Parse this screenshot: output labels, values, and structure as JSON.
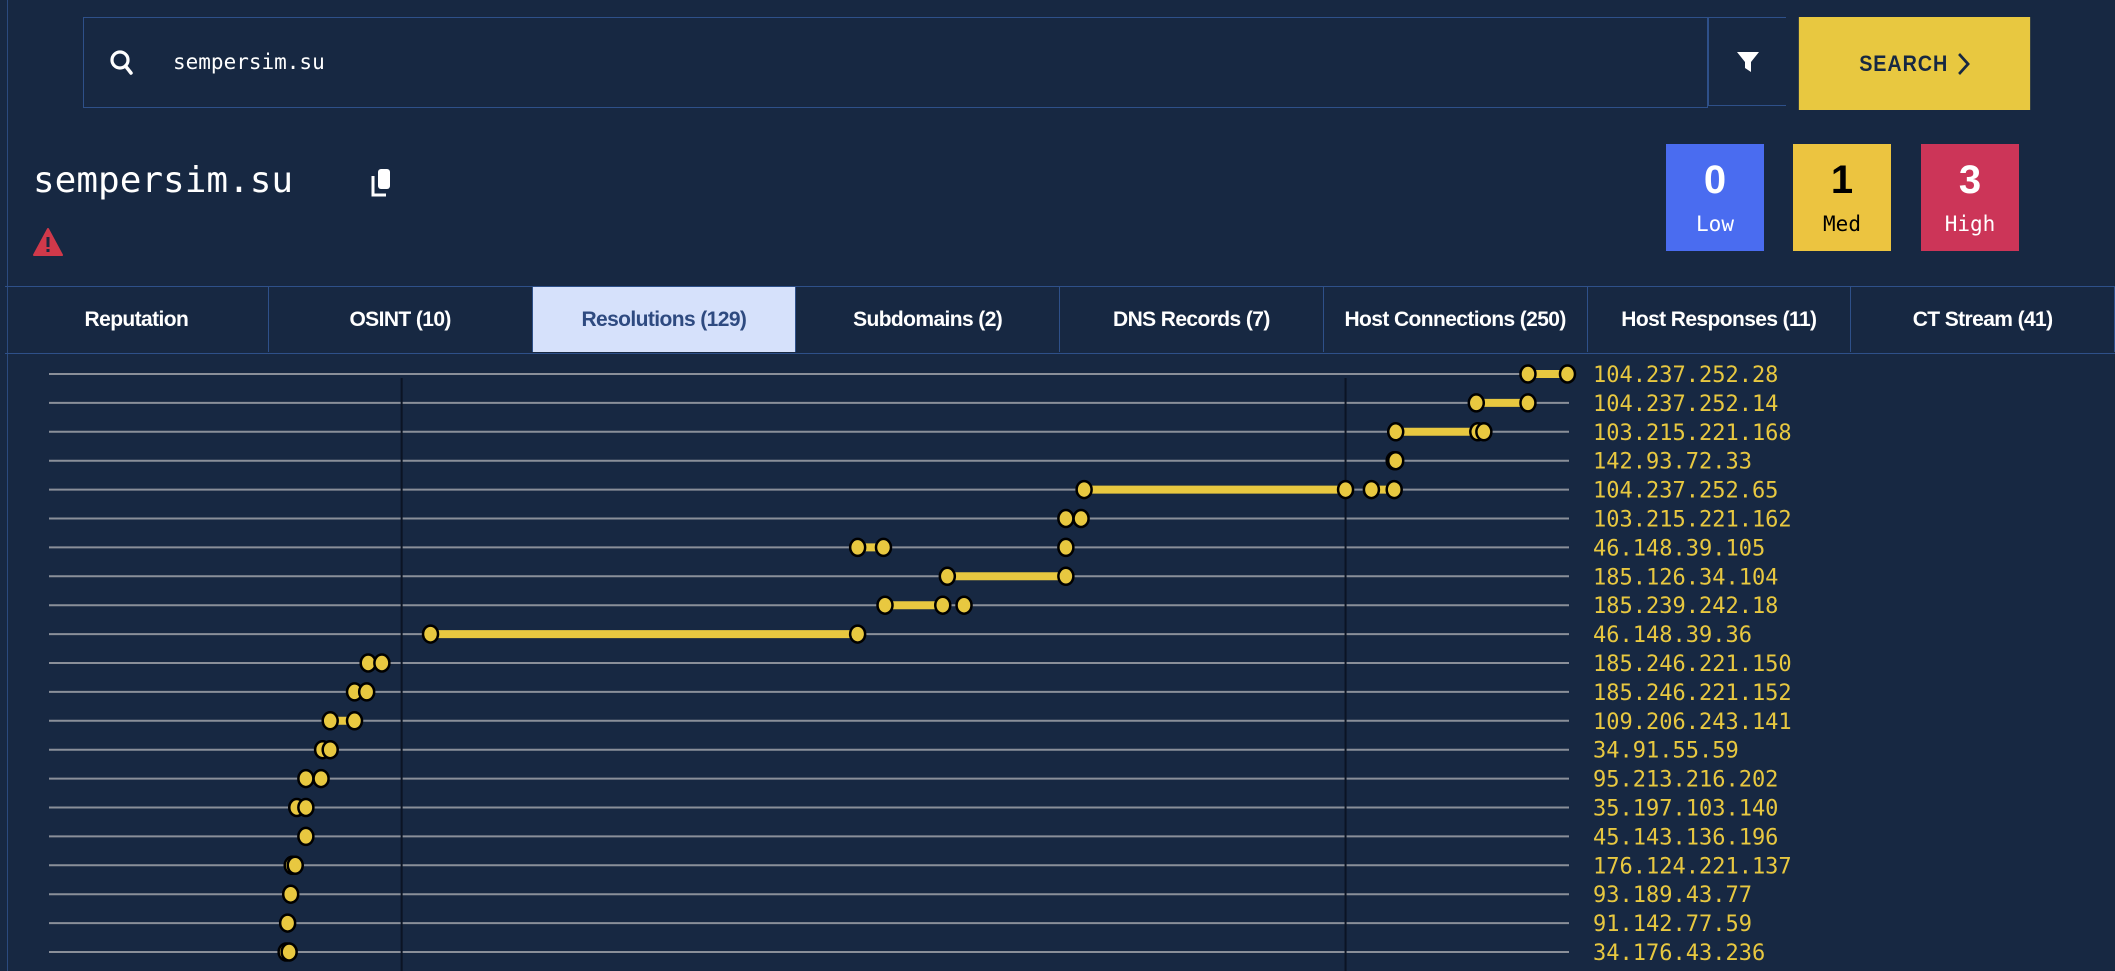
{
  "search": {
    "value": "sempersim.su",
    "icon": "search-icon",
    "filter_icon": "filter-icon",
    "button_label": "SEARCH",
    "button_icon": "chevron-right-icon"
  },
  "domain": {
    "title": "sempersim.su",
    "copy_icon": "copy-icon",
    "alert_icon": "warning-triangle-icon",
    "alert_color": "#d0394a"
  },
  "badges": [
    {
      "count": "0",
      "label": "Low",
      "color": "#4a6cf0"
    },
    {
      "count": "1",
      "label": "Med",
      "color": "#ecc440"
    },
    {
      "count": "3",
      "label": "High",
      "color": "#cc3558"
    }
  ],
  "tabs": [
    {
      "label": "Reputation"
    },
    {
      "label": "OSINT (10)"
    },
    {
      "label": "Resolutions (129)",
      "active": true
    },
    {
      "label": "Subdomains (2)"
    },
    {
      "label": "DNS Records (7)"
    },
    {
      "label": "Host Connections (250)"
    },
    {
      "label": "Host Responses (11)"
    },
    {
      "label": "CT Stream (41)"
    }
  ],
  "chart_data": {
    "type": "timeline",
    "scale": "relative timeline, percent of visible range",
    "marker_lines": [
      23.2,
      85.3
    ],
    "accent": "#e8c840",
    "rows": [
      {
        "ip": "104.237.252.28",
        "spans": [
          [
            97.3,
            99.9
          ]
        ],
        "points": [
          97.3,
          99.9
        ]
      },
      {
        "ip": "104.237.252.14",
        "spans": [
          [
            93.9,
            97.3
          ]
        ],
        "points": [
          93.9,
          97.3
        ]
      },
      {
        "ip": "103.215.221.168",
        "spans": [
          [
            88.6,
            94.0
          ]
        ],
        "points": [
          88.6,
          94.0,
          94.4
        ]
      },
      {
        "ip": "142.93.72.33",
        "spans": [],
        "points": [
          88.5,
          88.6
        ]
      },
      {
        "ip": "104.237.252.65",
        "spans": [
          [
            68.1,
            85.3
          ],
          [
            87.0,
            88.5
          ]
        ],
        "points": [
          68.1,
          85.3,
          87.0,
          88.5
        ]
      },
      {
        "ip": "103.215.221.162",
        "spans": [],
        "points": [
          66.9,
          67.9
        ]
      },
      {
        "ip": "46.148.39.105",
        "spans": [
          [
            53.2,
            54.9
          ]
        ],
        "points": [
          53.2,
          54.9,
          66.9
        ]
      },
      {
        "ip": "185.126.34.104",
        "spans": [
          [
            59.1,
            66.9
          ]
        ],
        "points": [
          59.1,
          66.9
        ]
      },
      {
        "ip": "185.239.242.18",
        "spans": [
          [
            55.0,
            58.8
          ]
        ],
        "points": [
          55.0,
          58.8,
          60.2
        ]
      },
      {
        "ip": "46.148.39.36",
        "spans": [
          [
            25.1,
            53.2
          ]
        ],
        "points": [
          25.1,
          53.2
        ]
      },
      {
        "ip": "185.246.221.150",
        "spans": [],
        "points": [
          21.0,
          21.9
        ]
      },
      {
        "ip": "185.246.221.152",
        "spans": [],
        "points": [
          20.1,
          20.9
        ]
      },
      {
        "ip": "109.206.243.141",
        "spans": [
          [
            18.5,
            20.1
          ]
        ],
        "points": [
          18.5,
          20.1
        ]
      },
      {
        "ip": "34.91.55.59",
        "spans": [],
        "points": [
          18.0,
          18.5
        ]
      },
      {
        "ip": "95.213.216.202",
        "spans": [],
        "points": [
          16.9,
          17.9
        ]
      },
      {
        "ip": "35.197.103.140",
        "spans": [],
        "points": [
          16.3,
          16.9
        ]
      },
      {
        "ip": "45.143.136.196",
        "spans": [],
        "points": [
          16.9
        ]
      },
      {
        "ip": "176.124.221.137",
        "spans": [],
        "points": [
          16.0,
          16.2
        ]
      },
      {
        "ip": "93.189.43.77",
        "spans": [],
        "points": [
          15.9
        ]
      },
      {
        "ip": "91.142.77.59",
        "spans": [],
        "points": [
          15.7
        ]
      },
      {
        "ip": "34.176.43.236",
        "spans": [],
        "points": [
          15.6,
          15.8
        ]
      }
    ]
  }
}
